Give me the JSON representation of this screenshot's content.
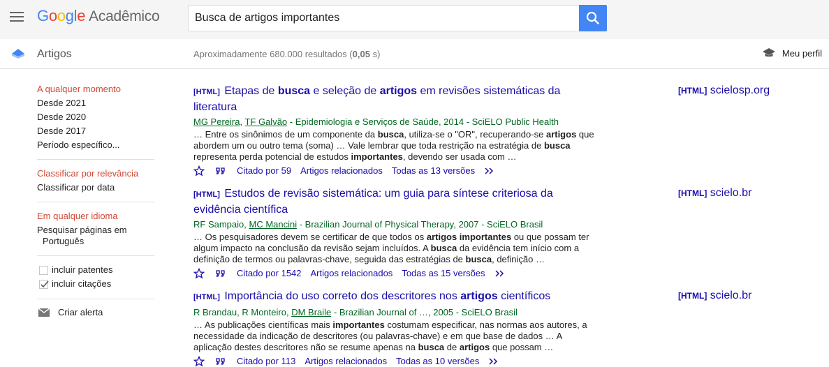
{
  "header": {
    "logo_letters": [
      "G",
      "o",
      "o",
      "g",
      "l",
      "e"
    ],
    "product": "Acadêmico",
    "search_value": "Busca de artigos importantes"
  },
  "subheader": {
    "section": "Artigos",
    "results_prefix": "Aproximadamente 680.000 resultados (",
    "results_time": "0,05",
    "results_suffix": " s)",
    "profile": "Meu perfil"
  },
  "sidebar": {
    "time": [
      "A qualquer momento",
      "Desde 2021",
      "Desde 2020",
      "Desde 2017",
      "Período específico..."
    ],
    "sort": [
      "Classificar por relevância",
      "Classificar por data"
    ],
    "lang": [
      "Em qualquer idioma",
      "Pesquisar páginas em",
      "Português"
    ],
    "include_patents": "incluir patentes",
    "include_citations": "incluir citações",
    "alert": "Criar alerta"
  },
  "results": [
    {
      "tag": "[HTML]",
      "title_parts": [
        [
          "Etapas de ",
          false
        ],
        [
          "busca",
          true
        ],
        [
          " e seleção de ",
          false
        ],
        [
          "artigos",
          true
        ],
        [
          " em revisões sistemáticas da literatura",
          false
        ]
      ],
      "authors": [
        [
          "MG Pereira",
          true
        ],
        [
          ", ",
          false
        ],
        [
          "TF Galvão",
          true
        ],
        [
          " - Epidemiologia e Serviços de Saúde, 2014 - SciELO Public Health",
          false
        ]
      ],
      "snippet_parts": [
        [
          "… Entre os sinônimos de um componente da ",
          false
        ],
        [
          "busca",
          true
        ],
        [
          ", utiliza-se o \"OR\", recuperando-se ",
          false
        ],
        [
          "artigos",
          true
        ],
        [
          " que abordem um ou outro tema (soma) … Vale lembrar que toda restrição na estratégia de ",
          false
        ],
        [
          "busca",
          true
        ],
        [
          " representa perda potencial de estudos ",
          false
        ],
        [
          "importantes",
          true
        ],
        [
          ", devendo ser usada com …",
          false
        ]
      ],
      "cited": "Citado por 59",
      "related": "Artigos relacionados",
      "versions": "Todas as 13 versões",
      "side_tag": "[HTML]",
      "side_domain": "scielosp.org"
    },
    {
      "tag": "[HTML]",
      "title_parts": [
        [
          "Estudos de revisão sistemática: um guia para síntese criteriosa da evidência científica",
          false
        ]
      ],
      "authors": [
        [
          "RF Sampaio, ",
          false
        ],
        [
          "MC Mancini",
          true
        ],
        [
          " - Brazilian Journal of Physical Therapy, 2007 - SciELO Brasil",
          false
        ]
      ],
      "snippet_parts": [
        [
          "… Os pesquisadores devem se certificar de que todos os ",
          false
        ],
        [
          "artigos importantes",
          true
        ],
        [
          " ou que possam ter algum impacto na conclusão da revisão sejam incluídos. A ",
          false
        ],
        [
          "busca",
          true
        ],
        [
          " da evidência tem início com a definição de termos ou palavras-chave, seguida das estratégias de ",
          false
        ],
        [
          "busca",
          true
        ],
        [
          ", definição …",
          false
        ]
      ],
      "cited": "Citado por 1542",
      "related": "Artigos relacionados",
      "versions": "Todas as 15 versões",
      "side_tag": "[HTML]",
      "side_domain": "scielo.br"
    },
    {
      "tag": "[HTML]",
      "title_parts": [
        [
          "Importância do uso correto dos descritores nos ",
          false
        ],
        [
          "artigos",
          true
        ],
        [
          " científicos",
          false
        ]
      ],
      "authors": [
        [
          "R Brandau, R Monteiro, ",
          false
        ],
        [
          "DM Braile",
          true
        ],
        [
          " - Brazilian Journal of …, 2005 - SciELO Brasil",
          false
        ]
      ],
      "snippet_parts": [
        [
          "… As publicações científicas mais ",
          false
        ],
        [
          "importantes",
          true
        ],
        [
          " costumam especificar, nas normas aos autores, a necessidade da indicação de descritores (ou palavras-chave) e em que base de dados … A aplicação destes descritores não se resume apenas na ",
          false
        ],
        [
          "busca",
          true
        ],
        [
          " de ",
          false
        ],
        [
          "artigos",
          true
        ],
        [
          " que possam …",
          false
        ]
      ],
      "cited": "Citado por 113",
      "related": "Artigos relacionados",
      "versions": "Todas as 10 versões",
      "side_tag": "[HTML]",
      "side_domain": "scielo.br"
    }
  ],
  "colors": {
    "accent": "#4285f4",
    "link": "#1a0dab",
    "green": "#006621",
    "active_red": "#d14836"
  }
}
